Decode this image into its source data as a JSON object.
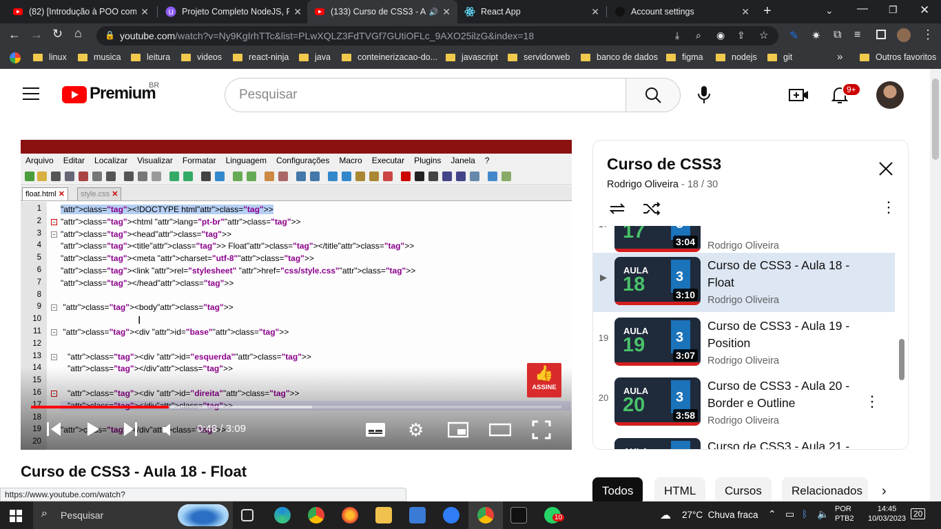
{
  "browser": {
    "tabs": [
      {
        "title": "(82) [Introdução à POO com",
        "active": false
      },
      {
        "title": "Projeto Completo NodeJS, Re",
        "active": false
      },
      {
        "title": "(133) Curso de CSS3 - Au",
        "active": true
      },
      {
        "title": "React App",
        "active": false
      },
      {
        "title": "Account settings",
        "active": false
      }
    ],
    "url_host": "youtube.com",
    "url_path": "/watch?v=Ny9KgIrhTTc&list=PLwXQLZ3FdTVGf7GUtiOFLc_9AXO25ilzG&index=18",
    "bookmarks": [
      "linux",
      "musica",
      "leitura",
      "videos",
      "react-ninja",
      "java",
      "conteinerizacao-do...",
      "javascript",
      "servidorweb",
      "banco de dados",
      "figma",
      "nodejs",
      "git"
    ],
    "bookmarks_more": "»",
    "other_bookmarks": "Outros favoritos"
  },
  "youtube": {
    "logo_text": "Premium",
    "logo_region": "BR",
    "search_placeholder": "Pesquisar",
    "notif_badge": "9+"
  },
  "player": {
    "editor_menu": [
      "Arquivo",
      "Editar",
      "Localizar",
      "Visualizar",
      "Formatar",
      "Linguagem",
      "Configurações",
      "Macro",
      "Executar",
      "Plugins",
      "Janela",
      "?"
    ],
    "editor_tabs": [
      "float.html",
      "style.css"
    ],
    "code_lines": [
      {
        "n": "1",
        "text": "<!DOCTYPE html>"
      },
      {
        "n": "2",
        "text": "<html lang=\"pt-br\">"
      },
      {
        "n": "3",
        "text": "<head>"
      },
      {
        "n": "4",
        "text": "<title> Float</title>"
      },
      {
        "n": "5",
        "text": "<meta charset=\"utf-8\">"
      },
      {
        "n": "6",
        "text": "<link rel=\"stylesheet\" href=\"css/style.css\">"
      },
      {
        "n": "7",
        "text": "</head>"
      },
      {
        "n": "8",
        "text": ""
      },
      {
        "n": "9",
        "text": " <body>"
      },
      {
        "n": "10",
        "text": ""
      },
      {
        "n": "11",
        "text": " <div id=\"base\">"
      },
      {
        "n": "12",
        "text": ""
      },
      {
        "n": "13",
        "text": "   <div id=\"esquerda\">"
      },
      {
        "n": "14",
        "text": "   </div>"
      },
      {
        "n": "15",
        "text": ""
      },
      {
        "n": "16",
        "text": "   <div id=\"direita\">"
      },
      {
        "n": "17",
        "text": "   </div>"
      },
      {
        "n": "18",
        "text": ""
      },
      {
        "n": "19",
        "text": "</div>"
      },
      {
        "n": "20",
        "text": ""
      }
    ],
    "assine_label": "ASSINE",
    "time_current": "0:48",
    "time_total": "3:09",
    "progress_fraction": 0.26,
    "buffered_fraction": 0.53
  },
  "video_title": "Curso de CSS3 - Aula 18 - Float",
  "playlist": {
    "title": "Curso de CSS3",
    "channel": "Rodrigo Oliveira",
    "position": "18 / 30",
    "items": [
      {
        "index": "17",
        "aula": "AULA",
        "num": "17",
        "duration": "3:04",
        "title": "",
        "channel": "Rodrigo Oliveira",
        "current": false
      },
      {
        "index": "▶",
        "aula": "AULA",
        "num": "18",
        "duration": "3:10",
        "title": "Curso de CSS3 - Aula 18 - Float",
        "channel": "Rodrigo Oliveira",
        "current": true
      },
      {
        "index": "19",
        "aula": "AULA",
        "num": "19",
        "duration": "3:07",
        "title": "Curso de CSS3 - Aula 19 - Position",
        "channel": "Rodrigo Oliveira",
        "current": false
      },
      {
        "index": "20",
        "aula": "AULA",
        "num": "20",
        "duration": "3:58",
        "title": "Curso de CSS3 - Aula 20 - Border e Outline",
        "channel": "Rodrigo Oliveira",
        "current": false
      },
      {
        "index": "21",
        "aula": "AULA",
        "num": "21",
        "duration": "",
        "title": "Curso de CSS3 - Aula 21 -",
        "channel": "",
        "current": false
      }
    ]
  },
  "chips": [
    "Todos",
    "HTML",
    "Cursos",
    "Relacionados"
  ],
  "status_url": "https://www.youtube.com/watch?v=DHS3r66DzaQ&list=PLwXQLZ3FdTVGf7GUtiOFLc_9AXO25ilzG&index=20",
  "taskbar": {
    "search_placeholder": "Pesquisar",
    "weather": "27°C  Chuva fraca",
    "lang_top": "POR",
    "lang_bottom": "PTB2",
    "time": "14:45",
    "date": "10/03/2023",
    "notif_count": "20",
    "whatsapp_badge": "10"
  },
  "colors": {
    "yt_red": "#ff0000",
    "chrome_dark": "#202124",
    "chrome_toolbar": "#35363a"
  }
}
